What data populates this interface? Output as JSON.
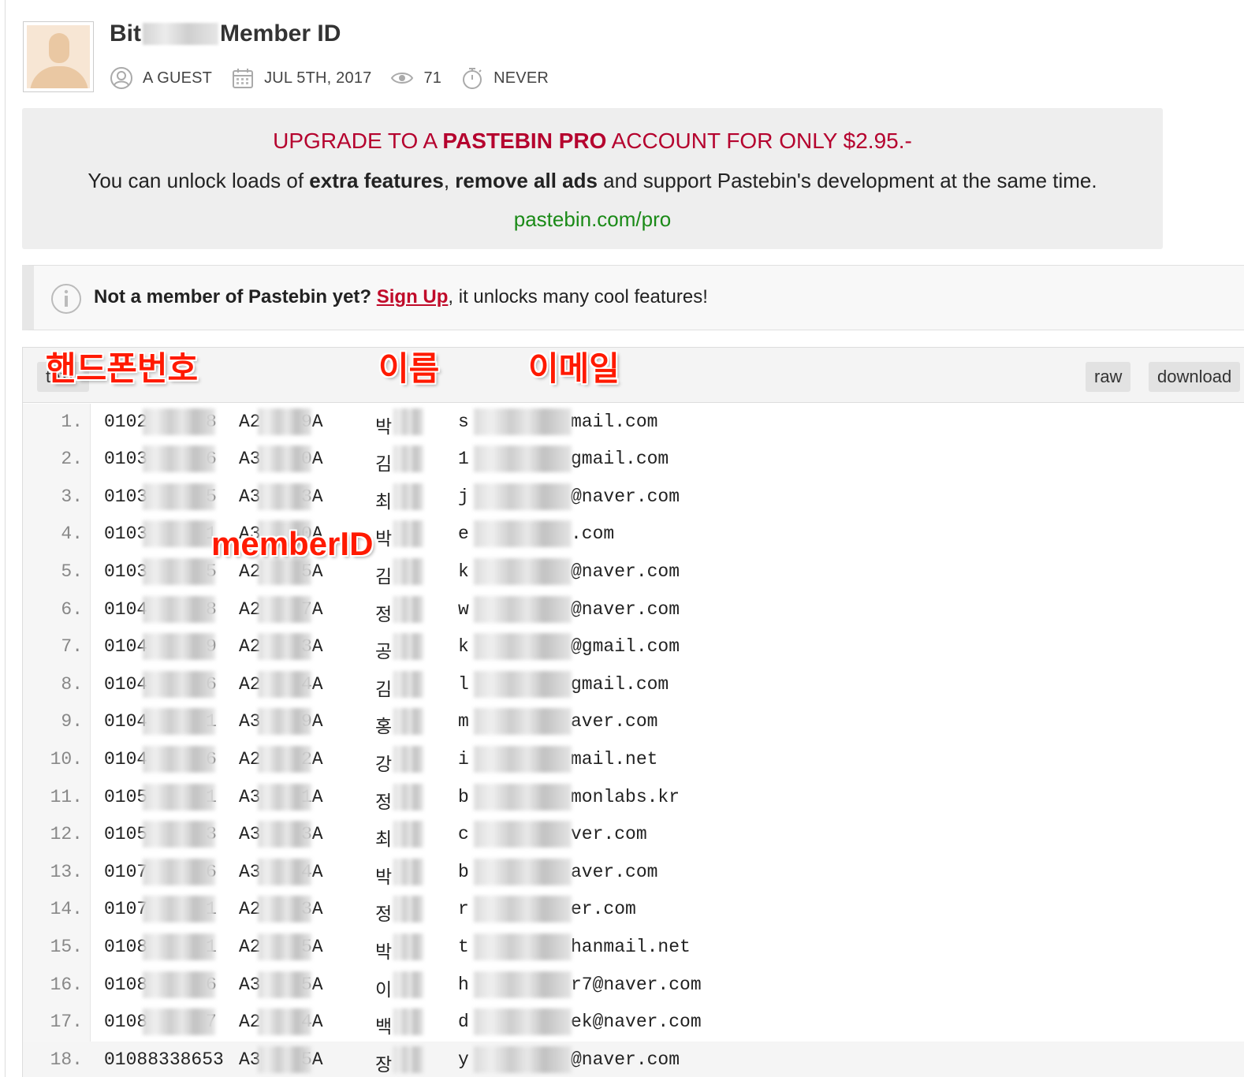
{
  "header": {
    "title_prefix": "Bit",
    "title_suffix": "Member ID",
    "author": "A GUEST",
    "date": "JUL 5TH, 2017",
    "views": "71",
    "expiry": "NEVER"
  },
  "pro_banner": {
    "line1_a": "UPGRADE TO A ",
    "line1_b": "PASTEBIN PRO",
    "line1_c": " ACCOUNT FOR ONLY $2.95.-",
    "line2_a": "You can unlock loads of ",
    "line2_b": "extra features",
    "line2_c": ", ",
    "line2_d": "remove all ads",
    "line2_e": " and support Pastebin's development at the same time.",
    "link": "pastebin.com/pro"
  },
  "notice": {
    "text_a": "Not a member of Pastebin yet? ",
    "signup": "Sign Up",
    "text_b": ", it unlocks many cool features!"
  },
  "toolbar": {
    "text_label": "text",
    "raw_label": "raw",
    "download_label": "download"
  },
  "annotations": {
    "phone": "핸드폰번호",
    "name": "이름",
    "email": "이메일",
    "member": "memberID"
  },
  "icons": {
    "author": "user-circle-icon",
    "date": "calendar-icon",
    "views": "eye-icon",
    "expiry": "stopwatch-icon",
    "notice": "info-icon"
  },
  "colors": {
    "pro_red": "#b5022e",
    "pro_link": "#1a8a17",
    "annotation": "#ff1a00",
    "signup_link": "#c00b2a"
  },
  "rows": [
    {
      "n": "1.",
      "pa": "0102",
      "pb": "8",
      "ma": "A2",
      "mb": "9A",
      "name": "박",
      "ea": "s",
      "eb": "mail.com"
    },
    {
      "n": "2.",
      "pa": "0103",
      "pb": "6",
      "ma": "A3",
      "mb": "0A",
      "name": "김",
      "ea": "1",
      "eb": "gmail.com"
    },
    {
      "n": "3.",
      "pa": "0103",
      "pb": "5",
      "ma": "A3",
      "mb": "3A",
      "name": "최",
      "ea": "j",
      "eb": "@naver.com"
    },
    {
      "n": "4.",
      "pa": "0103",
      "pb": "1",
      "ma": "A3",
      "mb": "0A",
      "name": "박",
      "ea": "e",
      "eb": ".com"
    },
    {
      "n": "5.",
      "pa": "0103",
      "pb": "5",
      "ma": "A2",
      "mb": "5A",
      "name": "김",
      "ea": "k",
      "eb": "@naver.com"
    },
    {
      "n": "6.",
      "pa": "0104",
      "pb": "8",
      "ma": "A2",
      "mb": "7A",
      "name": "정",
      "ea": "w",
      "eb": "@naver.com"
    },
    {
      "n": "7.",
      "pa": "0104",
      "pb": "9",
      "ma": "A2",
      "mb": "3A",
      "name": "공",
      "ea": "k",
      "eb": "@gmail.com"
    },
    {
      "n": "8.",
      "pa": "0104",
      "pb": "6",
      "ma": "A2",
      "mb": "4A",
      "name": "김",
      "ea": "l",
      "eb": "gmail.com"
    },
    {
      "n": "9.",
      "pa": "0104",
      "pb": "1",
      "ma": "A3",
      "mb": "9A",
      "name": "홍",
      "ea": "m",
      "eb": "aver.com"
    },
    {
      "n": "10.",
      "pa": "0104",
      "pb": "6",
      "ma": "A2",
      "mb": "2A",
      "name": "강",
      "ea": "i",
      "eb": "mail.net"
    },
    {
      "n": "11.",
      "pa": "0105",
      "pb": "1",
      "ma": "A3",
      "mb": "1A",
      "name": "정",
      "ea": "b",
      "eb": "monlabs.kr"
    },
    {
      "n": "12.",
      "pa": "0105",
      "pb": "3",
      "ma": "A3",
      "mb": "3A",
      "name": "최",
      "ea": "c",
      "eb": "ver.com"
    },
    {
      "n": "13.",
      "pa": "0107",
      "pb": "6",
      "ma": "A3",
      "mb": "4A",
      "name": "박",
      "ea": "b",
      "eb": "aver.com"
    },
    {
      "n": "14.",
      "pa": "0107",
      "pb": "1",
      "ma": "A2",
      "mb": "3A",
      "name": "정",
      "ea": "r",
      "eb": "er.com"
    },
    {
      "n": "15.",
      "pa": "0108",
      "pb": "1",
      "ma": "A2",
      "mb": "5A",
      "name": "박",
      "ea": "t",
      "eb": "hanmail.net"
    },
    {
      "n": "16.",
      "pa": "0108",
      "pb": "6",
      "ma": "A3",
      "mb": "5A",
      "name": "이",
      "ea": "h",
      "eb": "r7@naver.com"
    },
    {
      "n": "17.",
      "pa": "0108",
      "pb": "7",
      "ma": "A2",
      "mb": "4A",
      "name": "백",
      "ea": "d",
      "eb": "ek@naver.com"
    },
    {
      "n": "18.",
      "pa": "01088338653",
      "pb": "",
      "ma": "A3",
      "mb": "5A",
      "name": "장",
      "ea": "y",
      "eb": "@naver.com"
    }
  ]
}
